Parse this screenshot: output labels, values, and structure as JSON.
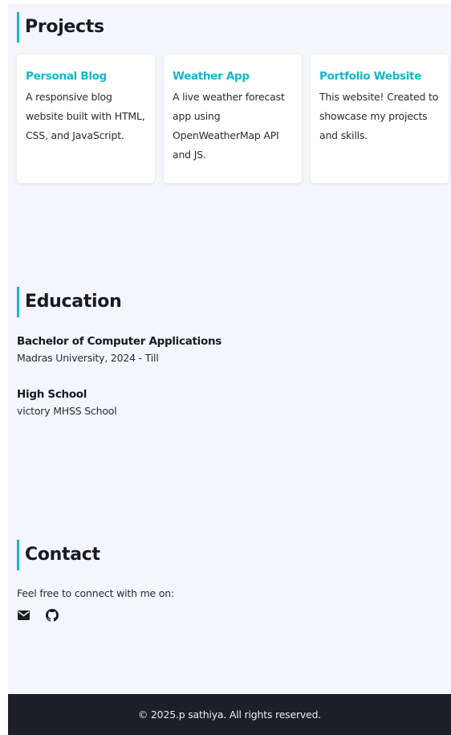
{
  "projects": {
    "title": "Projects",
    "items": [
      {
        "title": "Personal Blog",
        "desc": "A responsive blog website built with HTML, CSS, and JavaScript."
      },
      {
        "title": "Weather App",
        "desc": "A live weather forecast app using OpenWeatherMap API and JS."
      },
      {
        "title": "Portfolio Website",
        "desc": "This website! Created to showcase my projects and skills."
      }
    ]
  },
  "education": {
    "title": "Education",
    "items": [
      {
        "degree": "Bachelor of Computer Applications",
        "school": "Madras University, 2024 - Till"
      },
      {
        "degree": "High School",
        "school": "victory MHSS School"
      }
    ]
  },
  "contact": {
    "title": "Contact",
    "text": "Feel free to connect with me on:",
    "icons": [
      "envelope-icon",
      "github-icon"
    ]
  },
  "footer": {
    "text": "© 2025.p sathiya. All rights reserved."
  },
  "colors": {
    "accent": "#17b4cc",
    "background": "#f4f6fb",
    "footer": "#1e1e2a"
  }
}
